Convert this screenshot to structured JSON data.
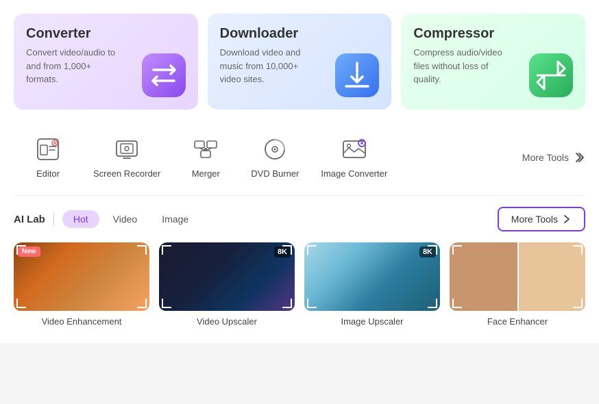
{
  "topCards": [
    {
      "id": "converter",
      "title": "Converter",
      "desc": "Convert video/audio to and from 1,000+ formats.",
      "bgClass": "card-converter",
      "iconColor": "#a855f7"
    },
    {
      "id": "downloader",
      "title": "Downloader",
      "desc": "Download video and music from 10,000+ video sites.",
      "bgClass": "card-downloader",
      "iconColor": "#3b82f6"
    },
    {
      "id": "compressor",
      "title": "Compressor",
      "desc": "Compress audio/video files without loss of quality.",
      "bgClass": "card-compressor",
      "iconColor": "#22c55e"
    }
  ],
  "tools": [
    {
      "id": "editor",
      "label": "Editor"
    },
    {
      "id": "screen-recorder",
      "label": "Screen Recorder"
    },
    {
      "id": "merger",
      "label": "Merger"
    },
    {
      "id": "dvd-burner",
      "label": "DVD Burner"
    },
    {
      "id": "image-converter",
      "label": "Image Converter"
    }
  ],
  "moreToolsLabel": "More Tools",
  "aiLab": {
    "sectionLabel": "AI Lab",
    "tabs": [
      {
        "id": "hot",
        "label": "Hot",
        "active": true
      },
      {
        "id": "video",
        "label": "Video",
        "active": false
      },
      {
        "id": "image",
        "label": "Image",
        "active": false
      }
    ],
    "moreToolsBtn": "More Tools",
    "cards": [
      {
        "id": "video-enhancement",
        "label": "Video Enhancement",
        "badge": "New",
        "res": null,
        "imgClass": "img-video-enhance"
      },
      {
        "id": "video-upscaler",
        "label": "Video Upscaler",
        "badge": null,
        "res": "8K",
        "imgClass": "img-video-upscale"
      },
      {
        "id": "image-upscaler",
        "label": "Image Upscaler",
        "badge": null,
        "res": "8K",
        "imgClass": "img-upscaler"
      },
      {
        "id": "face-enhancer",
        "label": "Face Enhancer",
        "badge": null,
        "res": null,
        "imgClass": "img-face-enhance"
      }
    ]
  }
}
